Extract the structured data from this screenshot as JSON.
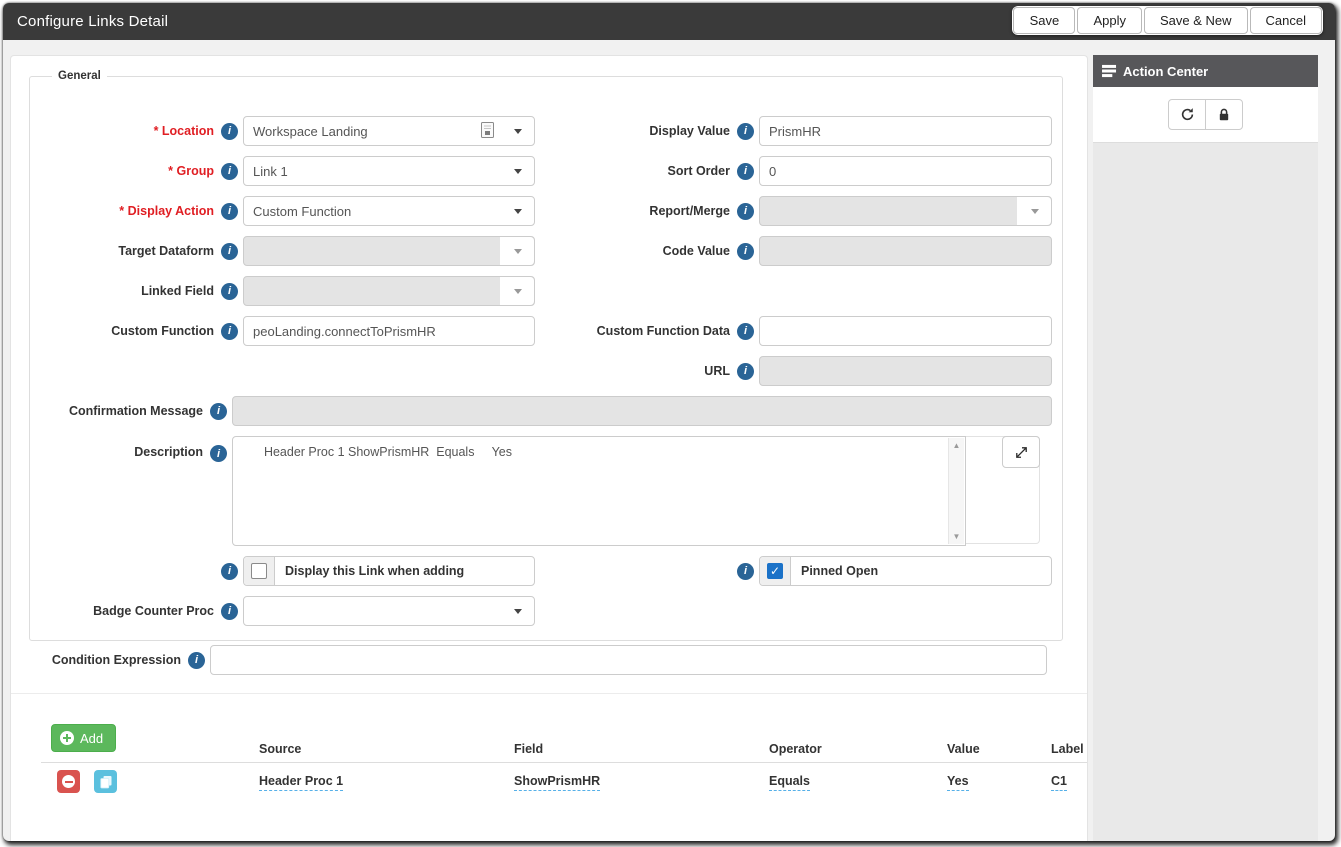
{
  "window": {
    "title": "Configure Links Detail"
  },
  "toolbar": {
    "save": "Save",
    "apply": "Apply",
    "save_new": "Save & New",
    "cancel": "Cancel"
  },
  "action_center": {
    "title": "Action Center",
    "icons": [
      "refresh-icon",
      "lock-icon"
    ]
  },
  "form": {
    "legend": "General",
    "location": {
      "label": "* Location",
      "value": "Workspace Landing"
    },
    "group": {
      "label": "* Group",
      "value": "Link 1"
    },
    "display_action": {
      "label": "* Display Action",
      "value": "Custom Function"
    },
    "target_dataform": {
      "label": "Target Dataform",
      "value": ""
    },
    "linked_field": {
      "label": "Linked Field",
      "value": ""
    },
    "custom_function": {
      "label": "Custom Function",
      "value": "peoLanding.connectToPrismHR"
    },
    "display_value": {
      "label": "Display Value",
      "value": "PrismHR"
    },
    "sort_order": {
      "label": "Sort Order",
      "value": "0"
    },
    "report_merge": {
      "label": "Report/Merge",
      "value": ""
    },
    "code_value": {
      "label": "Code Value",
      "value": ""
    },
    "custom_function_data": {
      "label": "Custom Function Data",
      "value": ""
    },
    "url": {
      "label": "URL",
      "value": ""
    },
    "confirmation_message": {
      "label": "Confirmation Message",
      "value": ""
    },
    "description": {
      "label": "Description",
      "value": "  Header Proc 1 ShowPrismHR  Equals     Yes"
    },
    "display_when_adding": {
      "label": "Display this Link when adding",
      "checked": false
    },
    "pinned_open": {
      "label": "Pinned Open",
      "checked": true
    },
    "badge_counter_proc": {
      "label": "Badge Counter Proc",
      "value": ""
    },
    "condition_expression": {
      "label": "Condition Expression",
      "value": ""
    }
  },
  "conditions": {
    "add_label": "Add",
    "columns": [
      "Source",
      "Field",
      "Operator",
      "Value",
      "Label"
    ],
    "row": {
      "source": "Header Proc 1",
      "field": "ShowPrismHR",
      "operator": "Equals",
      "value": "Yes",
      "label": "C1"
    }
  },
  "colors": {
    "titlebar_bg": "#3a3a3a",
    "required_label": "#e01e23",
    "info_icon": "#2a6496",
    "add_green": "#5cb85c",
    "delete_red": "#d9534f",
    "copy_cyan": "#5bc0de",
    "checkbox_blue": "#1b72c8",
    "disabled_bg": "#e4e4e4",
    "panel_header_bg": "#57575a"
  }
}
